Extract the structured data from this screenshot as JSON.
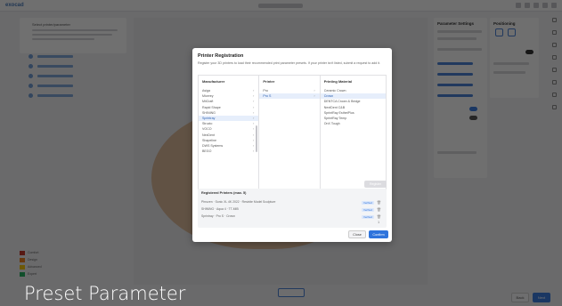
{
  "app": {
    "logo_text": "exocad",
    "colors": {
      "accent": "#3b7bdc",
      "overlay": "rgba(0,0,0,0.55)"
    }
  },
  "left_panel": {
    "title": "Select printer/parameter"
  },
  "legend": {
    "items": [
      {
        "label": "Comfort",
        "color": "#c0392b"
      },
      {
        "label": "Design",
        "color": "#e67e22"
      },
      {
        "label": "Advanced",
        "color": "#f1c40f"
      },
      {
        "label": "Expert",
        "color": "#27ae60"
      }
    ]
  },
  "right_panel": {
    "title": "Parameter Settings"
  },
  "far_right_panel": {
    "title": "Positioning",
    "support_wizard_label": "Support Wizard"
  },
  "bottom_buttons": {
    "back": "Back",
    "next": "Next"
  },
  "modal": {
    "title": "Printer Registration",
    "description": "Register your 3D printers to load their recommended print parameter presets. If your printer isn't listed, submit a request to add it.",
    "columns": {
      "manufacturer": {
        "header": "Manufacturer",
        "items": [
          "Asiga",
          "Micerey",
          "MiiCraft",
          "Rapid Shape",
          "SHINING",
          "Sprintray",
          "Structo",
          "VOCO",
          "NexDent",
          "Shapeline",
          "DWS Systems",
          "BEGO"
        ],
        "selected_index": 5
      },
      "printer": {
        "header": "Printer",
        "items": [
          "Pro",
          "Pro S"
        ],
        "selected_index": 1
      },
      "material": {
        "header": "Printing Material",
        "items": [
          "Ceramic Crown",
          "Crown",
          "DENTCA Crown & Bridge",
          "NextDent C&B",
          "SprintRay EsthetPlus",
          "SprintRay Temp",
          "OnX Tough"
        ],
        "selected_index": 1
      }
    },
    "register_button": "Register",
    "registered": {
      "title": "Registered Printers (max. 5)",
      "rows": [
        {
          "text": "Phrozen · Sonic XL 4K 2022 · Resinite Model Sculpture",
          "badge": "Verified"
        },
        {
          "text": "SHINING · Aqua 4 · TT-MIB",
          "badge": "Verified"
        },
        {
          "text": "Sprintray · Pro S · Crown",
          "badge": "Verified"
        }
      ],
      "page_indicator": "1"
    },
    "close_button": "Close",
    "confirm_button": "Confirm"
  },
  "caption": "Preset Parameter"
}
